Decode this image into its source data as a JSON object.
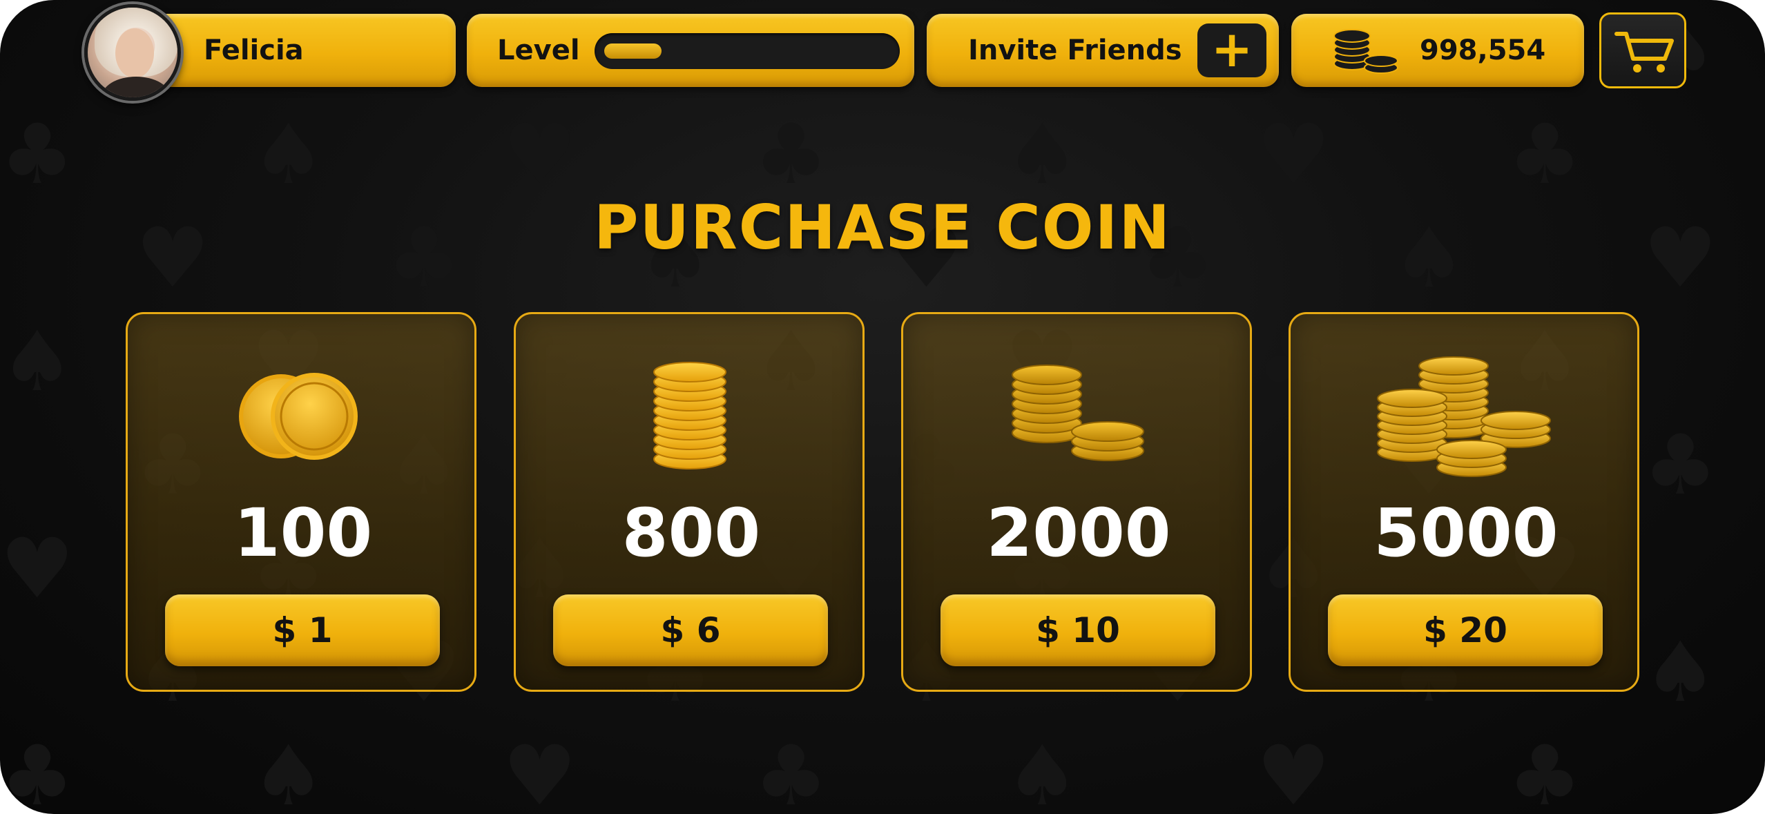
{
  "player": {
    "name": "Felicia"
  },
  "level": {
    "label": "Level",
    "progress": 0.2
  },
  "invite": {
    "label": "Invite Friends",
    "plus": "+"
  },
  "balance": {
    "coins": "998,554"
  },
  "title": "PURCHASE COIN",
  "packages": [
    {
      "amount": "100",
      "price": "$ 1"
    },
    {
      "amount": "800",
      "price": "$ 6"
    },
    {
      "amount": "2000",
      "price": "$ 10"
    },
    {
      "amount": "5000",
      "price": "$ 20"
    }
  ],
  "icons": {
    "cart": "shopping-cart-icon",
    "coins": "coin-stack-icon"
  },
  "colors": {
    "accent": "#f0b90b",
    "background": "#0d0d0d",
    "text_dark": "#121212",
    "text_light": "#ffffff"
  }
}
